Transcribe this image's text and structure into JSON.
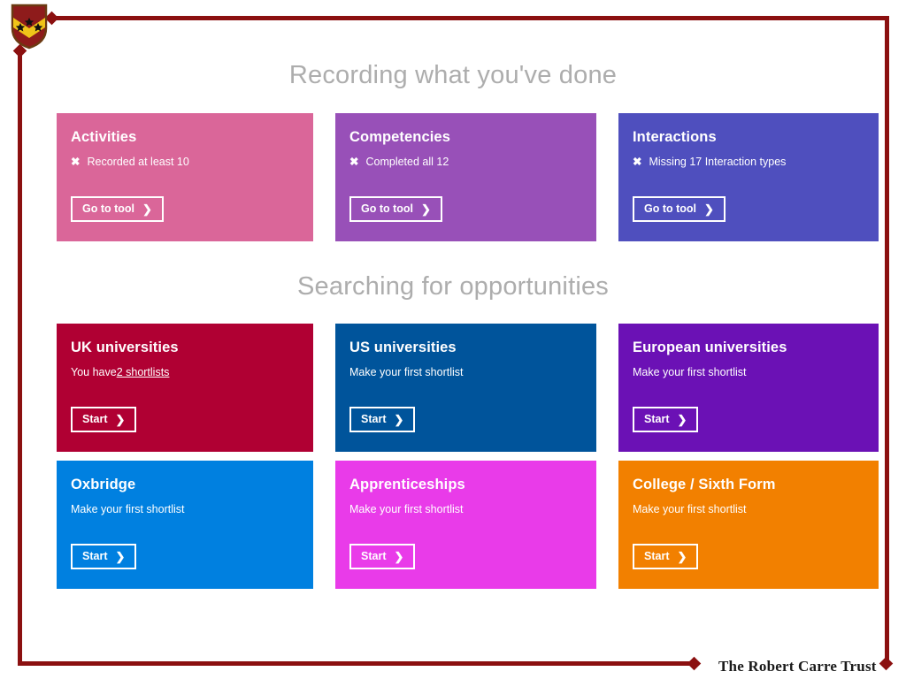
{
  "brand": {
    "footer_text": "The Robert Carre Trust",
    "crest_name": "robert-carre-trust-crest",
    "frame_color": "#8B1010",
    "crest_shield_color": "#8E1B1B",
    "crest_chevron_color": "#F0C419",
    "crest_star_color": "#111111"
  },
  "sections": [
    {
      "title": "Recording what you've done",
      "cards": [
        {
          "title": "Activities",
          "status_icon": "cross-icon",
          "status_text": "Recorded at least 10",
          "button_label": "Go to tool",
          "button_chevron": "chevron-right-icon",
          "color": "#DA6699"
        },
        {
          "title": "Competencies",
          "status_icon": "cross-icon",
          "status_text": "Completed all 12",
          "button_label": "Go to tool",
          "button_chevron": "chevron-right-icon",
          "color": "#9850B8"
        },
        {
          "title": "Interactions",
          "status_icon": "cross-icon",
          "status_text": "Missing 17 Interaction types",
          "button_label": "Go to tool",
          "button_chevron": "chevron-right-icon",
          "color": "#4F4FBE"
        }
      ]
    },
    {
      "title": "Searching for opportunities",
      "cards_row1": [
        {
          "title": "UK universities",
          "sub_prefix": "You have ",
          "sub_link": "2 shortlists",
          "status_text": "",
          "button_label": "Start",
          "button_chevron": "chevron-right-icon",
          "color": "#B00033"
        },
        {
          "title": "US universities",
          "sub_prefix": "",
          "sub_link": "",
          "status_text": "Make your first shortlist",
          "button_label": "Start",
          "button_chevron": "chevron-right-icon",
          "color": "#00549B"
        },
        {
          "title": "European universities",
          "sub_prefix": "",
          "sub_link": "",
          "status_text": "Make your first shortlist",
          "button_label": "Start",
          "button_chevron": "chevron-right-icon",
          "color": "#6B11B5"
        }
      ],
      "cards_row2": [
        {
          "title": "Oxbridge",
          "status_text": "Make your first shortlist",
          "button_label": "Start",
          "button_chevron": "chevron-right-icon",
          "color": "#0080E0"
        },
        {
          "title": "Apprenticeships",
          "status_text": "Make your first shortlist",
          "button_label": "Start",
          "button_chevron": "chevron-right-icon",
          "color": "#E93BE9"
        },
        {
          "title": "College / Sixth Form",
          "status_text": "Make your first shortlist",
          "button_label": "Start",
          "button_chevron": "chevron-right-icon",
          "color": "#F28000"
        }
      ]
    }
  ]
}
